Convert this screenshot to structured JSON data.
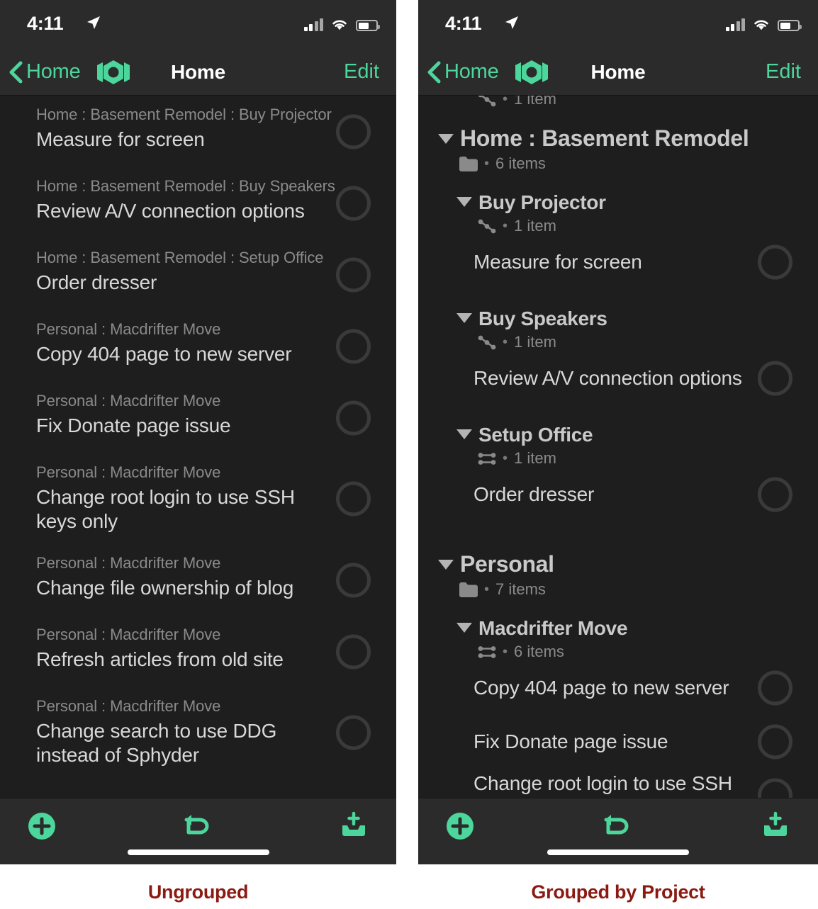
{
  "statusbar": {
    "time": "4:11",
    "location_icon": "location-arrow-icon",
    "cell_icon": "cellular-signal-icon",
    "wifi_icon": "wifi-icon",
    "battery_icon": "battery-icon"
  },
  "navbar": {
    "back_label": "Home",
    "back_icon": "chevron-left-icon",
    "perspective_icon": "omnifocus-perspective-icon",
    "title": "Home",
    "edit_label": "Edit"
  },
  "toolbar": {
    "add_icon": "plus-circle-icon",
    "undo_icon": "undo-arrow-icon",
    "inbox_icon": "add-to-inbox-icon",
    "accent_color": "#4cd69b"
  },
  "captions": {
    "left": "Ungrouped",
    "right": "Grouped by Project",
    "color": "#8b1a12"
  },
  "ungrouped": {
    "tasks": [
      {
        "context": "Home : Basement Remodel : Buy Projector",
        "title": "Measure for screen"
      },
      {
        "context": "Home : Basement Remodel : Buy Speakers",
        "title": "Review A/V connection options"
      },
      {
        "context": "Home : Basement Remodel : Setup Office",
        "title": "Order dresser"
      },
      {
        "context": "Personal : Macdrifter Move",
        "title": "Copy 404 page to new server"
      },
      {
        "context": "Personal : Macdrifter Move",
        "title": "Fix Donate page issue"
      },
      {
        "context": "Personal : Macdrifter Move",
        "title": "Change root login to use SSH keys only"
      },
      {
        "context": "Personal : Macdrifter Move",
        "title": "Change file ownership of blog"
      },
      {
        "context": "Personal : Macdrifter Move",
        "title": "Refresh articles from old site"
      },
      {
        "context": "Personal : Macdrifter Move",
        "title": "Change search to use DDG instead of Sphyder"
      }
    ]
  },
  "grouped": {
    "clipped_top_meta": {
      "icon": "sequential-icon",
      "count": "1 item"
    },
    "groups": [
      {
        "title": "Home : Basement Remodel",
        "icon": "folder-icon",
        "count": "6 items",
        "subgroups": [
          {
            "title": "Buy Projector",
            "icon": "sequential-icon",
            "count": "1 item",
            "tasks": [
              "Measure for screen"
            ]
          },
          {
            "title": "Buy Speakers",
            "icon": "sequential-icon",
            "count": "1 item",
            "tasks": [
              "Review A/V connection options"
            ]
          },
          {
            "title": "Setup Office",
            "icon": "parallel-icon",
            "count": "1 item",
            "tasks": [
              "Order dresser"
            ]
          }
        ]
      },
      {
        "title": "Personal",
        "icon": "folder-icon",
        "count": "7 items",
        "subgroups": [
          {
            "title": "Macdrifter Move",
            "icon": "parallel-icon",
            "count": "6 items",
            "tasks": [
              "Copy 404 page to new server",
              "Fix Donate page issue",
              "Change root login to use SSH keys only"
            ]
          }
        ]
      }
    ]
  }
}
